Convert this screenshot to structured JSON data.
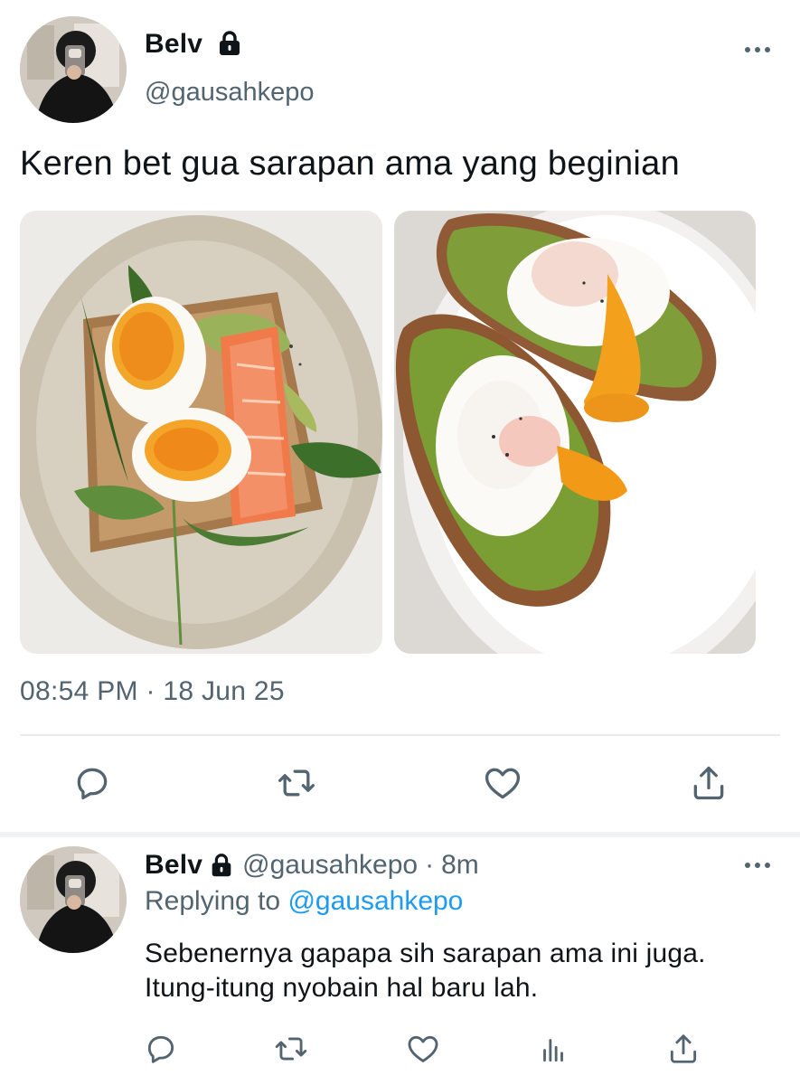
{
  "main_tweet": {
    "display_name": "Belv",
    "handle": "@gausahkepo",
    "text": "Keren bet gua sarapan ama yang beginian",
    "timestamp": "08:54 PM · 18 Jun 25",
    "icons": {
      "more": "more-horizontal-icon",
      "lock": "lock-icon",
      "reply": "reply-icon",
      "retweet": "retweet-icon",
      "like": "heart-icon",
      "share": "share-icon"
    }
  },
  "reply_tweet": {
    "display_name": "Belv",
    "handle": "@gausahkepo",
    "separator": "·",
    "time_ago": "8m",
    "replying_label": "Replying to",
    "replying_handle": "@gausahkepo",
    "text": "Sebenernya gapapa sih sarapan ama ini juga. Itung-itung nyobain hal baru lah.",
    "icons": {
      "reply": "reply-icon",
      "retweet": "retweet-icon",
      "like": "heart-icon",
      "analytics": "analytics-icon",
      "share": "share-icon"
    }
  },
  "colors": {
    "text": "#0f1419",
    "muted": "#536471",
    "link": "#1d9bf0",
    "divider": "#e8eaed"
  }
}
